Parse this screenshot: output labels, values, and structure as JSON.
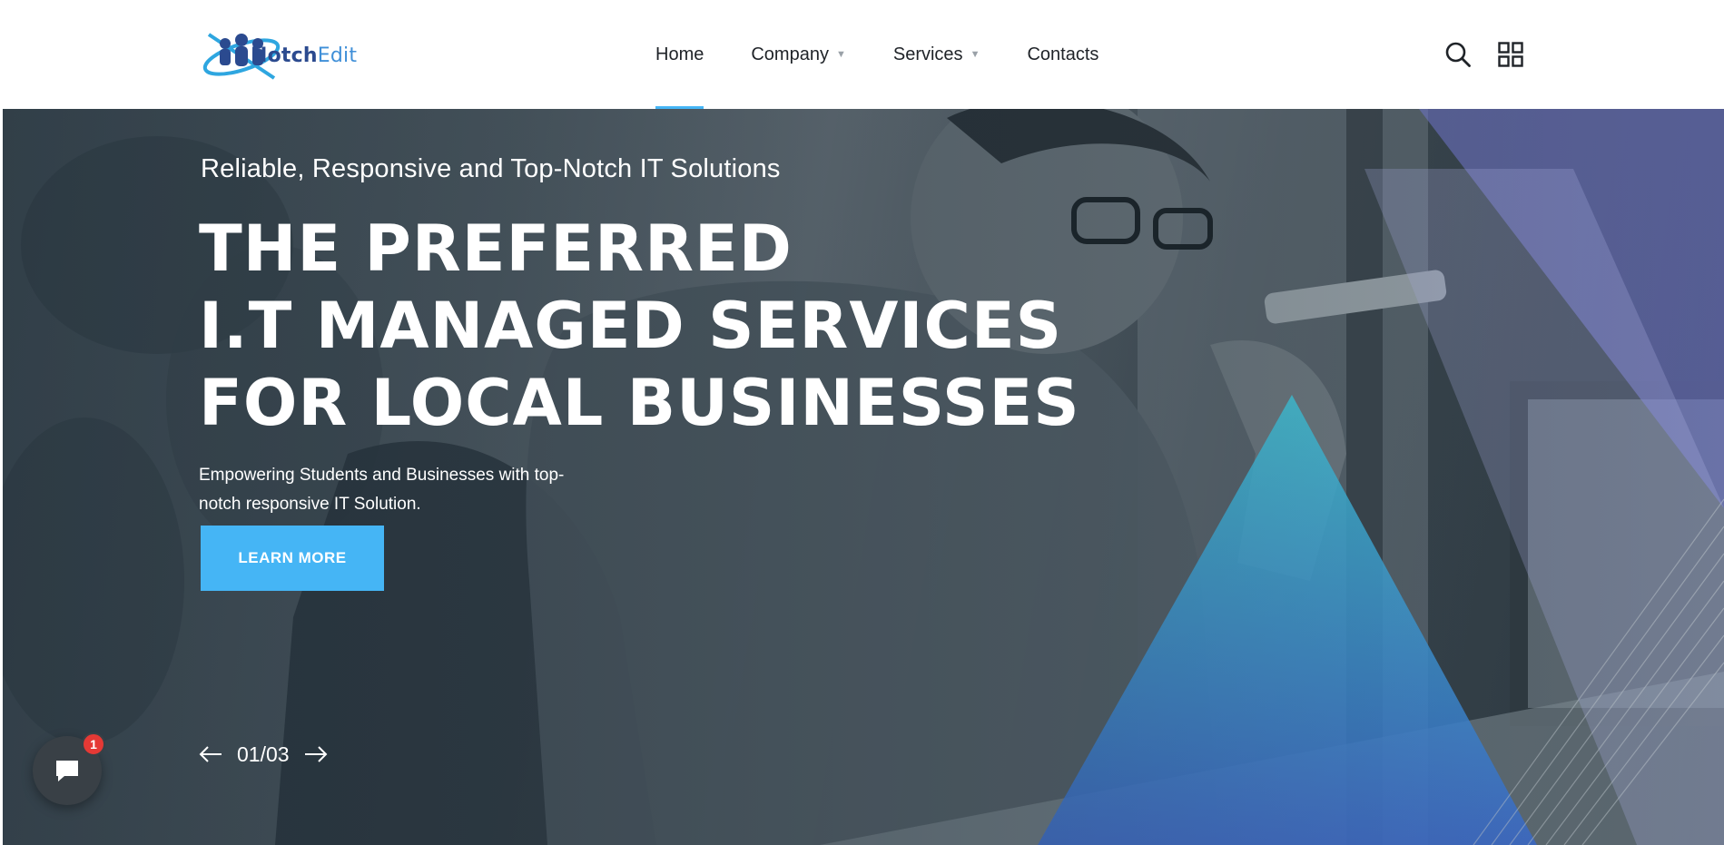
{
  "brand": {
    "name_part1": "Notch",
    "name_part2": "Edit",
    "colors": {
      "primary": "#2b4a8f",
      "accent": "#45b5f5"
    }
  },
  "nav": {
    "items": [
      {
        "label": "Home",
        "active": true,
        "has_dropdown": false
      },
      {
        "label": "Company",
        "active": false,
        "has_dropdown": true
      },
      {
        "label": "Services",
        "active": false,
        "has_dropdown": true
      },
      {
        "label": "Contacts",
        "active": false,
        "has_dropdown": false
      }
    ],
    "caret": "▼"
  },
  "header_icons": {
    "search": "search-icon",
    "menu": "grid-menu-icon"
  },
  "hero": {
    "tagline": "Reliable, Responsive and Top-Notch IT Solutions",
    "headline_lines": [
      "THE PREFERRED",
      "I.T MANAGED SERVICES",
      "FOR LOCAL BUSINESSES"
    ],
    "subtext": "Empowering Students and Businesses with top-notch responsive IT Solution.",
    "cta_label": "LEARN MORE",
    "slide_counter": "01/03"
  },
  "chat_widget": {
    "icon": "chat-bubble-icon",
    "badge_count": "1"
  }
}
